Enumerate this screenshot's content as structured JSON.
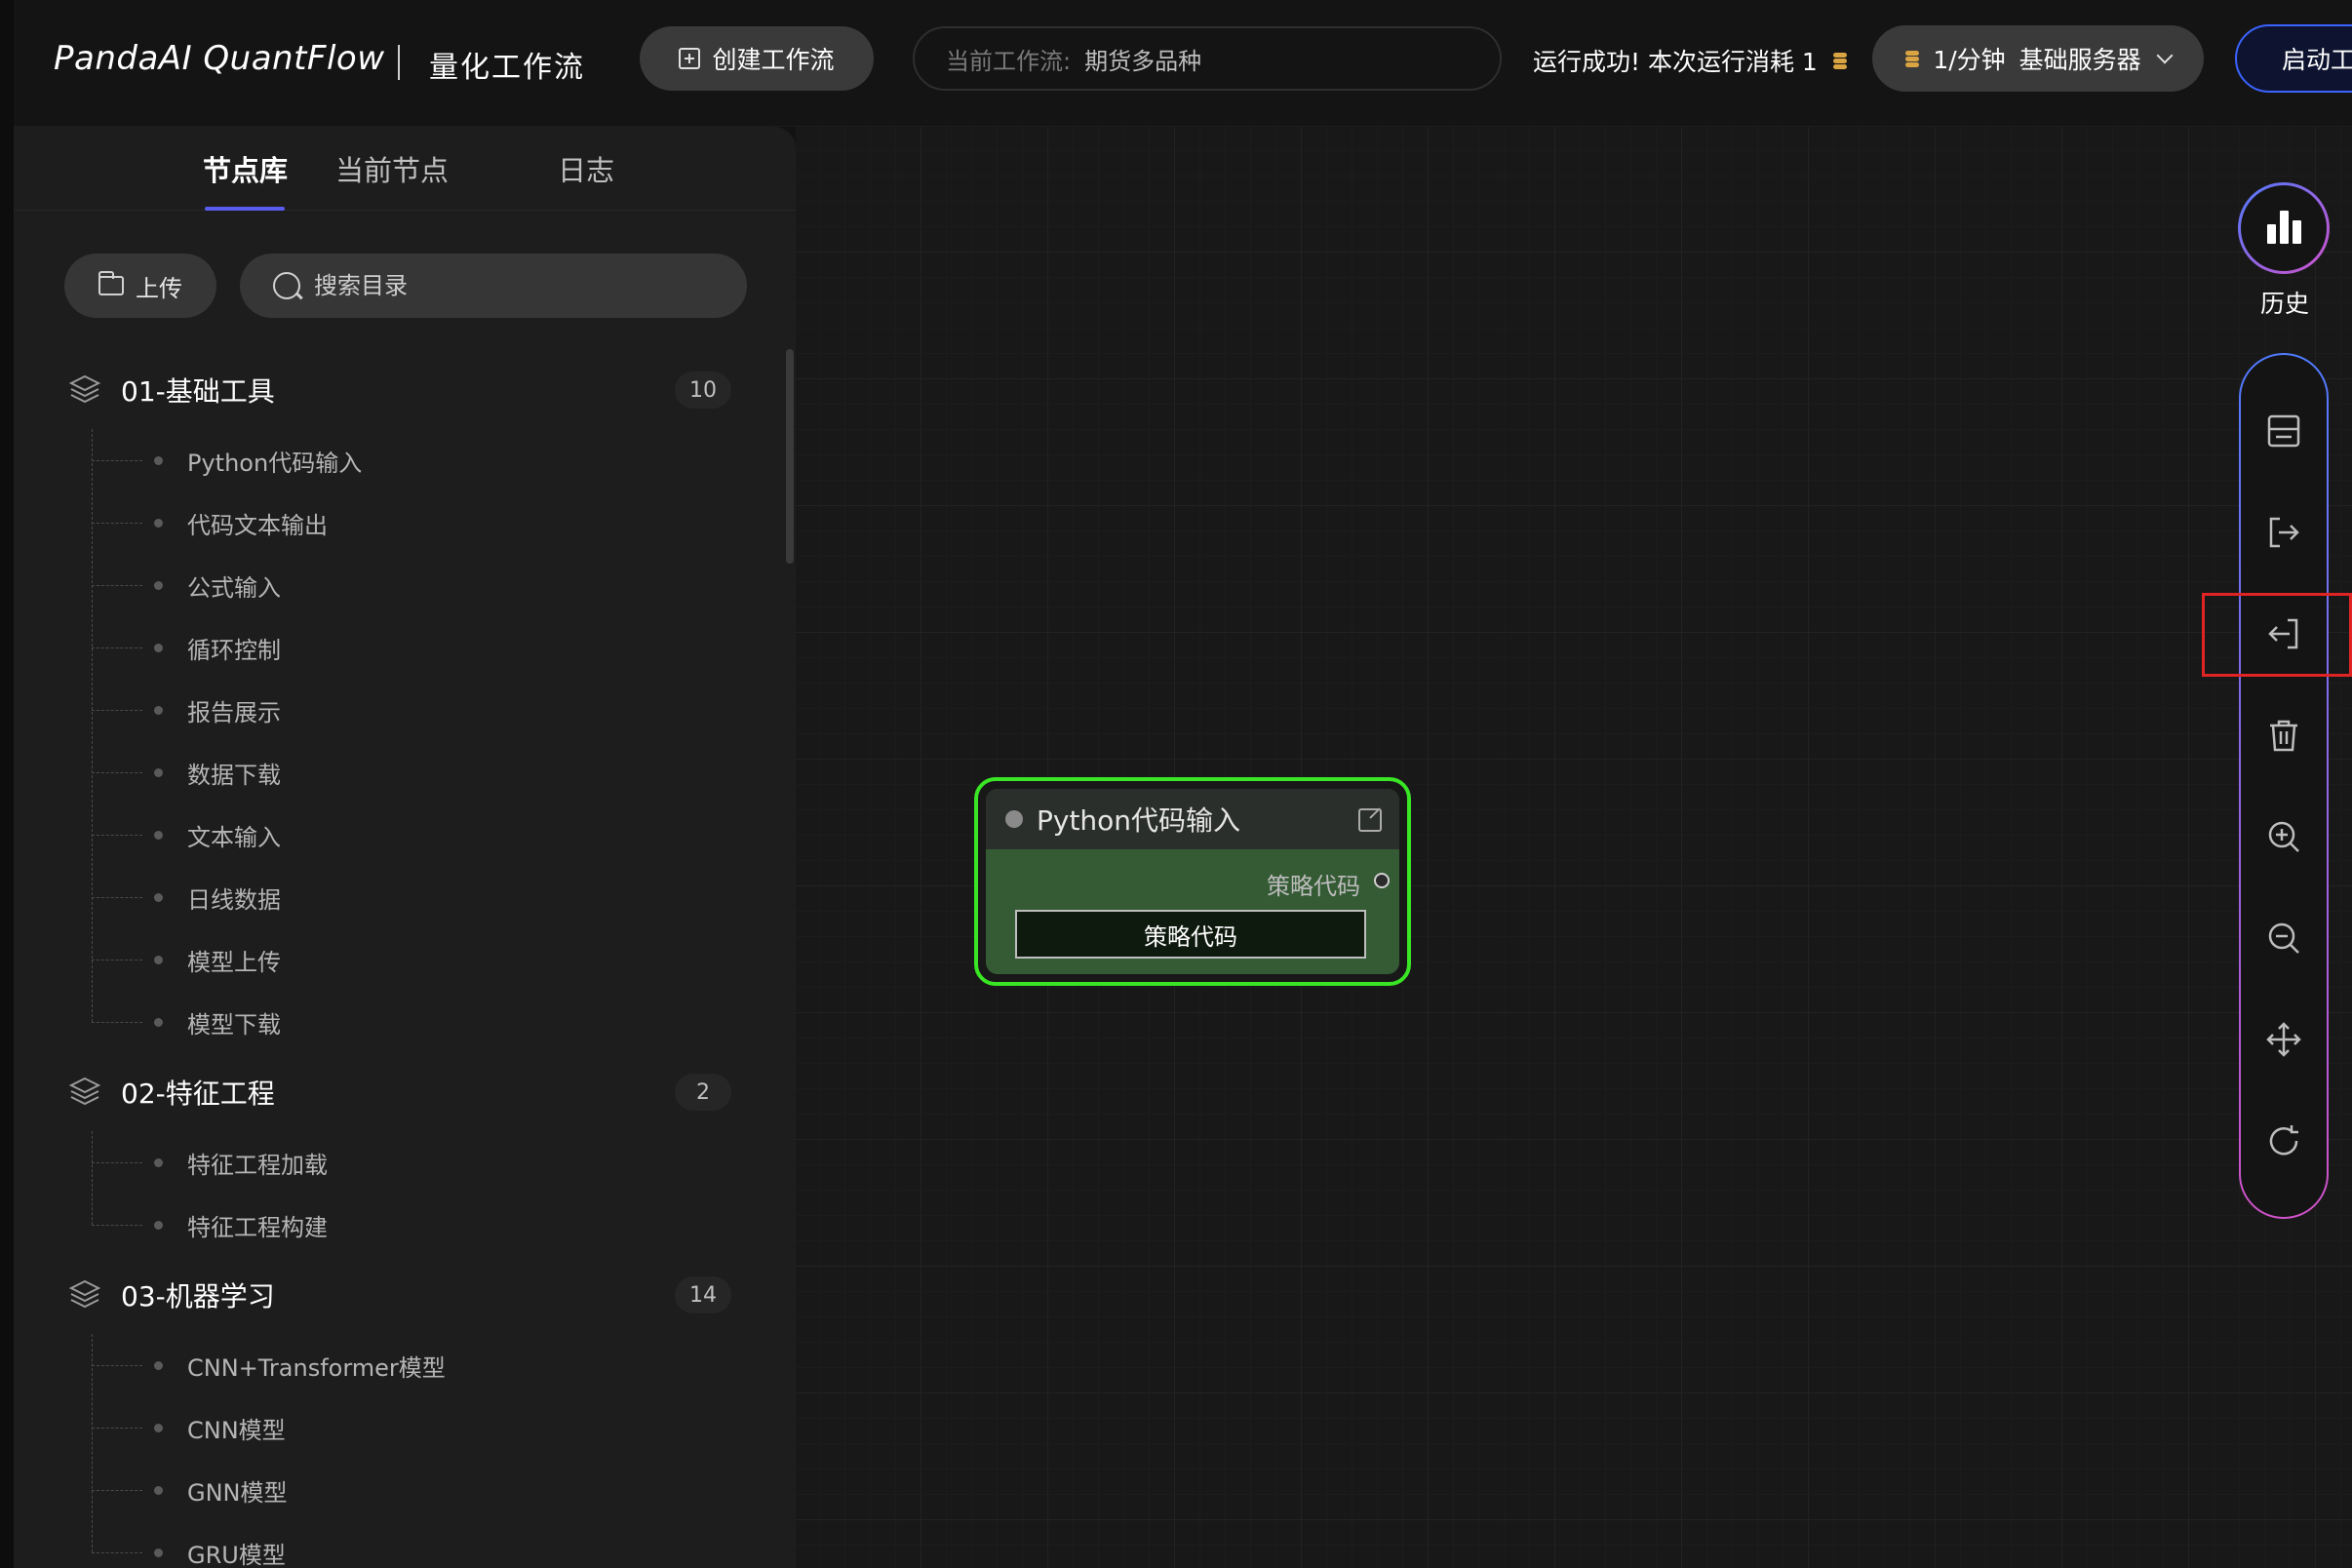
{
  "header": {
    "brand": "PandaAI QuantFlow",
    "subtitle": "量化工作流",
    "create_button": "创建工作流",
    "workflow_label": "当前工作流:",
    "workflow_value": "期货多品种",
    "run_status": "运行成功!  本次运行消耗 1",
    "server_rate": "1/分钟",
    "server_name": "基础服务器",
    "start_button": "启动工作流"
  },
  "left_panel": {
    "tabs": [
      "节点库",
      "当前节点",
      "日志"
    ],
    "active_tab": 0,
    "upload_button": "上传",
    "search_placeholder": "搜索目录",
    "groups": [
      {
        "title": "01-基础工具",
        "count": "10",
        "items": [
          "Python代码输入",
          "代码文本输出",
          "公式输入",
          "循环控制",
          "报告展示",
          "数据下载",
          "文本输入",
          "日线数据",
          "模型上传",
          "模型下载"
        ]
      },
      {
        "title": "02-特征工程",
        "count": "2",
        "items": [
          "特征工程加载",
          "特征工程构建"
        ]
      },
      {
        "title": "03-机器学习",
        "count": "14",
        "items": [
          "CNN+Transformer模型",
          "CNN模型",
          "GNN模型",
          "GRU模型"
        ]
      }
    ]
  },
  "canvas": {
    "node": {
      "title": "Python代码输入",
      "port_label": "策略代码",
      "button_label": "策略代码"
    }
  },
  "right_toolbar": {
    "history_label": "历史",
    "tools": [
      "save-icon",
      "export-icon",
      "import-icon",
      "delete-icon",
      "zoom-in-icon",
      "zoom-out-icon",
      "move-icon",
      "refresh-icon"
    ]
  },
  "colors": {
    "accent": "#5b5bf0",
    "node_border": "#39e524",
    "node_body": "#355b35",
    "start_border": "#3b63ff",
    "highlight": "#e02424"
  }
}
